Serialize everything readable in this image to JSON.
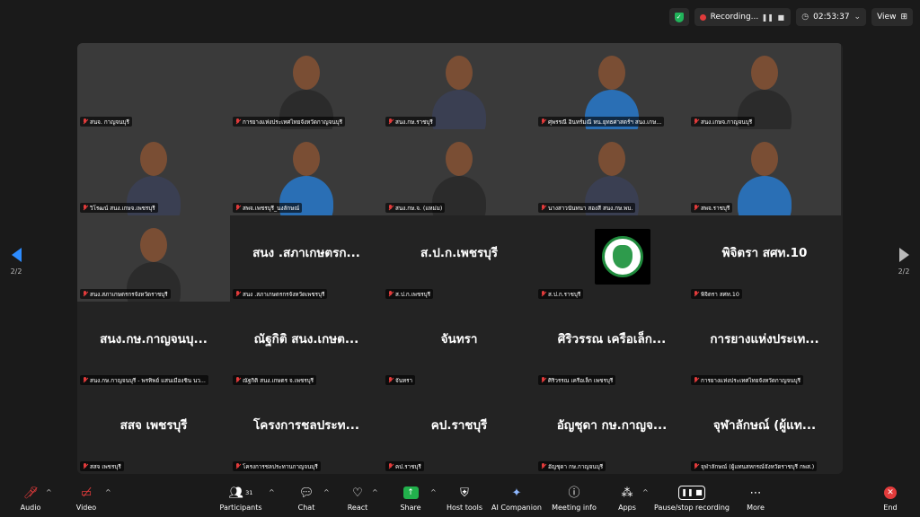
{
  "topbar": {
    "recording_label": "Recording...",
    "timer": "02:53:37",
    "view_label": "View"
  },
  "page_indicator": {
    "left": "2/2",
    "right": "2/2"
  },
  "tiles": [
    {
      "name": "สนจ. กาญจนบุรี",
      "video": "green",
      "big": ""
    },
    {
      "name": "การยางแห่งประเทศไทยจังหวัดกาญจนบุรี",
      "video": "light",
      "big": ""
    },
    {
      "name": "สนง.กษ.ราชบุรี",
      "video": "office",
      "big": ""
    },
    {
      "name": "ศุพรรณี อินทร์มณี หน.ยุทธศาสตร์ฯ สนง.เกษ...",
      "video": "sunset",
      "big": ""
    },
    {
      "name": "สนง.เกษจ.กาญจนบุรี",
      "video": "white",
      "big": ""
    },
    {
      "name": "วิโรฒน์ สนง.เกษจ.เพชรบุรี",
      "video": "light",
      "big": ""
    },
    {
      "name": "สพจ.เพชรบุรี_นงลักษณ์",
      "video": "warm",
      "big": ""
    },
    {
      "name": "สนง.กษ.จ. (แหม่ม)",
      "video": "dark",
      "big": ""
    },
    {
      "name": "นางสาวนันทนา สองสี สนง.กษ.พบ.",
      "video": "warm",
      "big": ""
    },
    {
      "name": "สพจ.ราชบุรี",
      "video": "car",
      "big": ""
    },
    {
      "name": "สนง.สภาเกษตรกรจังหวัดราชบุรี",
      "video": "yellow",
      "big": ""
    },
    {
      "name": "สนง .สภาเกษตรกรจังหวัดเพชรบุรี",
      "video": "none",
      "big": "สนง .สภาเกษตรก..."
    },
    {
      "name": "ส.ป.ก.เพชรบุรี",
      "video": "none",
      "big": "ส.ป.ก.เพชรบุรี"
    },
    {
      "name": "ส.ป.ก.ราชบุรี",
      "video": "logo",
      "big": ""
    },
    {
      "name": "พิจิตรา สศท.10",
      "video": "none",
      "big": "พิจิตรา สศท.10"
    },
    {
      "name": "สนง.กษ.กาญจนบุรี - พรทิพย์ แสนเมืองชิน นว...",
      "video": "none",
      "big": "สนง.กษ.กาญจนบุ..."
    },
    {
      "name": "ณัฐกิติ สนง.เกษตร จ.เพชรบุรี",
      "video": "none",
      "big": "ณัฐกิติ สนง.เกษต..."
    },
    {
      "name": "จันทรา",
      "video": "none",
      "big": "จันทรา"
    },
    {
      "name": "ศิริวรรณ เครือเล็ก เพชรบุรี",
      "video": "none",
      "big": "ศิริวรรณ เครือเล็ก..."
    },
    {
      "name": "การยางแห่งประเทศไทยจังหวัดกาญจนบุรี",
      "video": "none",
      "big": "การยางแห่งประเท..."
    },
    {
      "name": "สสจ เพชรบุรี",
      "video": "none",
      "big": "สสจ เพชรบุรี"
    },
    {
      "name": "โครงการชลประทานกาญจนบุรี",
      "video": "none",
      "big": "โครงการชลประท..."
    },
    {
      "name": "คป.ราชบุรี",
      "video": "none",
      "big": "คป.ราชบุรี"
    },
    {
      "name": "อัญชุดา กษ.กาญจนบุรี",
      "video": "none",
      "big": "อัญชุดา กษ.กาญจ..."
    },
    {
      "name": "จุฬาลักษณ์ (ผู้แทนสหกรณ์จังหวัดราชบุรี กพส.)",
      "video": "none",
      "big": "จุฬาลักษณ์ (ผู้แท..."
    }
  ],
  "toolbar": {
    "audio": "Audio",
    "video": "Video",
    "participants": "Participants",
    "participants_count": "31",
    "chat": "Chat",
    "react": "React",
    "share": "Share",
    "host_tools": "Host tools",
    "ai_companion": "AI Companion",
    "meeting_info": "Meeting info",
    "apps": "Apps",
    "pause_recording": "Pause/stop recording",
    "more": "More",
    "end": "End"
  },
  "colors": {
    "accent": "#2d8cff",
    "share_green": "#22b14c",
    "muted_red": "#e23b3b",
    "background": "#1a1a1a",
    "tile_bg": "#232323"
  }
}
